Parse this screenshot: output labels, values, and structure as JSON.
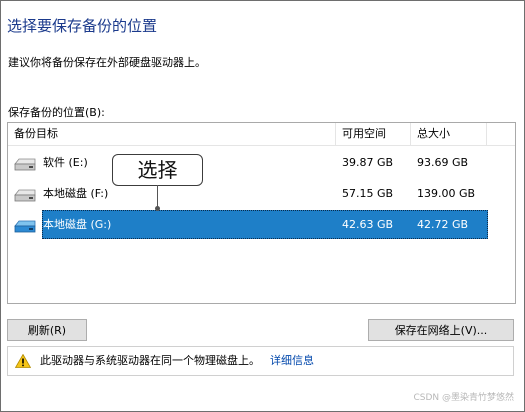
{
  "window": {
    "title": "选择要保存备份的位置",
    "subtitle": "建议你将备份保存在外部硬盘驱动器上。",
    "location_label": "保存备份的位置(B):"
  },
  "list": {
    "columns": [
      "备份目标",
      "可用空间",
      "总大小"
    ],
    "rows": [
      {
        "name": "软件 (E:)",
        "free": "39.87 GB",
        "total": "93.69 GB",
        "icon": "drive-icon",
        "selected": false
      },
      {
        "name": "本地磁盘 (F:)",
        "free": "57.15 GB",
        "total": "139.00 GB",
        "icon": "drive-icon",
        "selected": false
      },
      {
        "name": "本地磁盘 (G:)",
        "free": "42.63 GB",
        "total": "42.72 GB",
        "icon": "drive-icon",
        "selected": true
      }
    ]
  },
  "callout": {
    "text": "选择"
  },
  "buttons": {
    "refresh": "刷新(R)",
    "save_network": "保存在网络上(V)..."
  },
  "warning": {
    "text": "此驱动器与系统驱动器在同一个物理磁盘上。",
    "link": "详细信息",
    "icon": "warning-icon"
  },
  "watermark": "CSDN @墨染青竹梦悠然",
  "colors": {
    "title": "#1b3a8c",
    "selection": "#1e7fc8",
    "link": "#0047ab"
  }
}
